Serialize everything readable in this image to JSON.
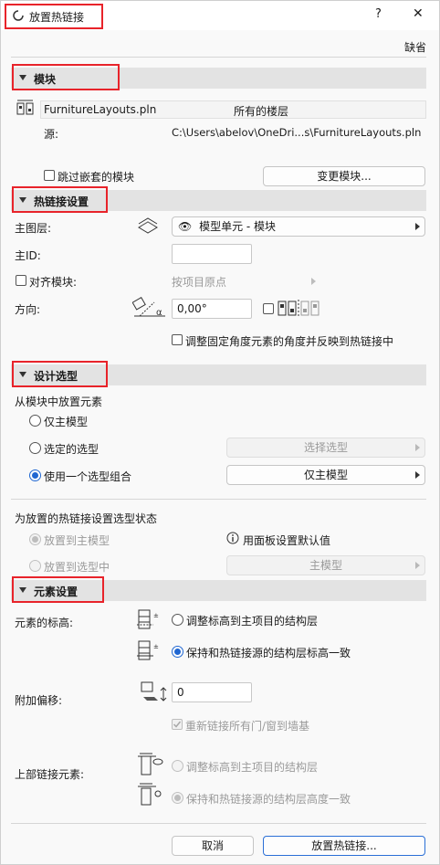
{
  "title": "放置热链接",
  "window_buttons": {
    "help": "?",
    "close": "✕"
  },
  "default_label": "缺省",
  "module_section": {
    "header": "模块",
    "file_name": "FurnitureLayouts.pln",
    "stories": "所有的楼层",
    "source_label": "源:",
    "source_path": "C:\\Users\\abelov\\OneDri...s\\FurnitureLayouts.pln",
    "skip_nested_label": "跳过嵌套的模块",
    "change_module_button": "变更模块..."
  },
  "hotlink_settings": {
    "header": "热链接设置",
    "master_layer_label": "主图层:",
    "master_layer_value": "模型单元 - 模块",
    "master_id_label": "主ID:",
    "master_id_value": "",
    "align_module_label": "对齐模块:",
    "align_value": "按项目原点",
    "orientation_label": "方向:",
    "orientation_value": "0,00°",
    "adjust_angle_label": "调整固定角度元素的角度并反映到热链接中"
  },
  "design_options": {
    "header": "设计选型",
    "place_from_label": "从模块中放置元素",
    "opt_main_model": "仅主模型",
    "opt_selected": "选定的选型",
    "opt_selected_button": "选择选型",
    "opt_combination": "使用一个选型组合",
    "opt_combination_value": "仅主模型",
    "status_label": "为放置的热链接设置选型状态",
    "status_main": "放置到主模型",
    "status_panel_default": "用面板设置默认值",
    "status_into_option": "放置到选型中",
    "status_into_option_value": "主模型"
  },
  "element_settings": {
    "header": "元素设置",
    "elevation_label": "元素的标高:",
    "elev_opt1": "调整标高到主项目的结构层",
    "elev_opt2": "保持和热链接源的结构层标高一致",
    "offset_label": "附加偏移:",
    "offset_value": "0",
    "relink_label": "重新链接所有门/窗到墙基",
    "top_link_label": "上部链接元素:",
    "top_opt1": "调整标高到主项目的结构层",
    "top_opt2": "保持和热链接源的结构层高度一致"
  },
  "footer": {
    "cancel": "取消",
    "place": "放置热链接..."
  },
  "accent_color": "#1f66d1",
  "highlight_color": "#e8232a"
}
